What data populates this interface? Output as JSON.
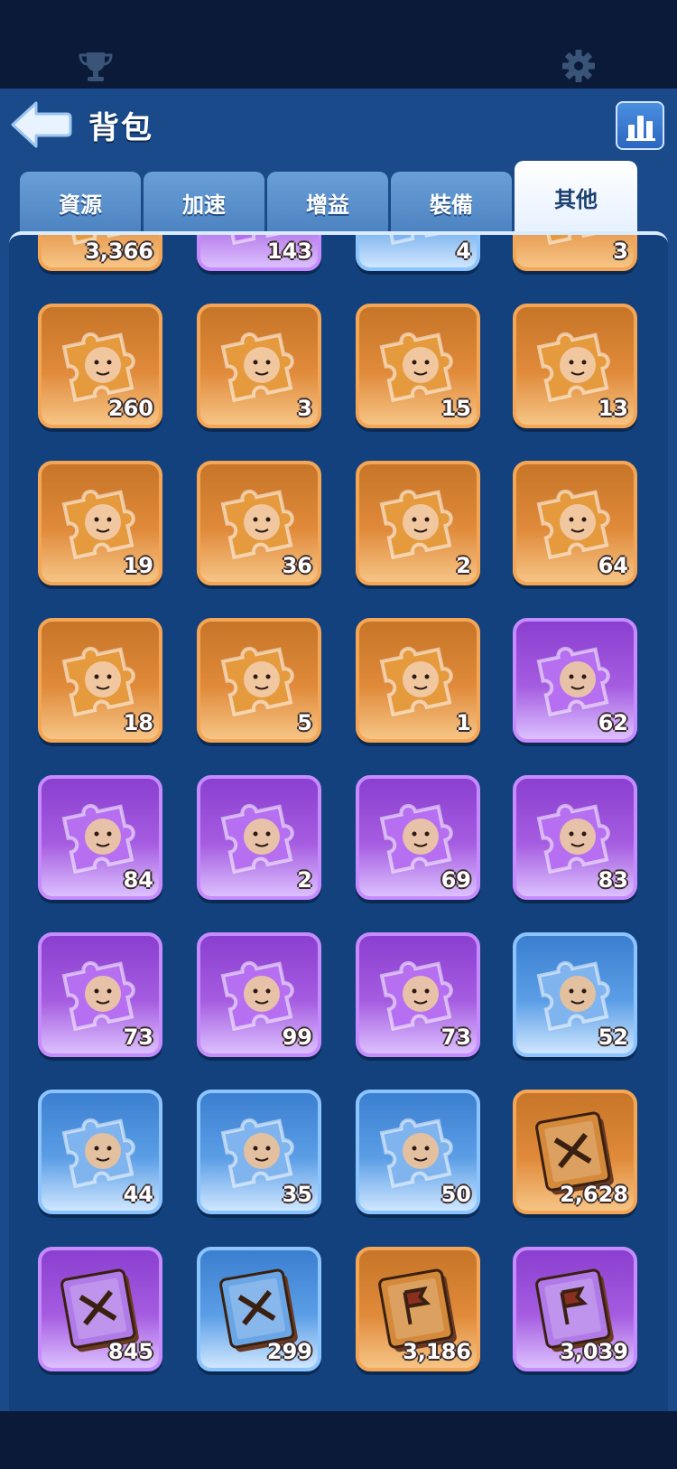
{
  "header": {
    "title": "背包"
  },
  "tabs": [
    {
      "label": "資源"
    },
    {
      "label": "加速"
    },
    {
      "label": "增益"
    },
    {
      "label": "裝備"
    },
    {
      "label": "其他",
      "active": true
    }
  ],
  "colors": {
    "orange": "#e08a3a",
    "purple": "#a55ce0",
    "blue": "#5b9ee6",
    "panel": "#12417e"
  },
  "items": [
    {
      "type": "hero-fragment",
      "rarity": "orange",
      "count": "3,366"
    },
    {
      "type": "hero-fragment",
      "rarity": "purple",
      "count": "143"
    },
    {
      "type": "hero-fragment",
      "rarity": "blue",
      "count": "4"
    },
    {
      "type": "hero-fragment",
      "rarity": "orange",
      "count": "3"
    },
    {
      "type": "hero-fragment",
      "rarity": "orange",
      "count": "260"
    },
    {
      "type": "hero-fragment",
      "rarity": "orange",
      "count": "3"
    },
    {
      "type": "hero-fragment",
      "rarity": "orange",
      "count": "15"
    },
    {
      "type": "hero-fragment",
      "rarity": "orange",
      "count": "13"
    },
    {
      "type": "hero-fragment",
      "rarity": "orange",
      "count": "19"
    },
    {
      "type": "hero-fragment",
      "rarity": "orange",
      "count": "36"
    },
    {
      "type": "hero-fragment",
      "rarity": "orange",
      "count": "2"
    },
    {
      "type": "hero-fragment",
      "rarity": "orange",
      "count": "64"
    },
    {
      "type": "hero-fragment",
      "rarity": "orange",
      "count": "18"
    },
    {
      "type": "hero-fragment",
      "rarity": "orange",
      "count": "5"
    },
    {
      "type": "hero-fragment",
      "rarity": "orange",
      "count": "1"
    },
    {
      "type": "hero-fragment",
      "rarity": "purple",
      "count": "62"
    },
    {
      "type": "hero-fragment",
      "rarity": "purple",
      "count": "84"
    },
    {
      "type": "hero-fragment",
      "rarity": "purple",
      "count": "2"
    },
    {
      "type": "hero-fragment",
      "rarity": "purple",
      "count": "69"
    },
    {
      "type": "hero-fragment",
      "rarity": "purple",
      "count": "83"
    },
    {
      "type": "hero-fragment",
      "rarity": "purple",
      "count": "73"
    },
    {
      "type": "hero-fragment",
      "rarity": "purple",
      "count": "99"
    },
    {
      "type": "hero-fragment",
      "rarity": "purple",
      "count": "73"
    },
    {
      "type": "hero-fragment",
      "rarity": "blue",
      "count": "52"
    },
    {
      "type": "hero-fragment",
      "rarity": "blue",
      "count": "44"
    },
    {
      "type": "hero-fragment",
      "rarity": "blue",
      "count": "35"
    },
    {
      "type": "hero-fragment",
      "rarity": "blue",
      "count": "50"
    },
    {
      "type": "skill-book-swords",
      "rarity": "orange",
      "count": "2,628"
    },
    {
      "type": "skill-book-swords",
      "rarity": "purple",
      "count": "845"
    },
    {
      "type": "skill-book-swords",
      "rarity": "blue",
      "count": "299"
    },
    {
      "type": "skill-book-flag",
      "rarity": "orange",
      "count": "3,186"
    },
    {
      "type": "skill-book-flag",
      "rarity": "purple",
      "count": "3,039"
    }
  ]
}
